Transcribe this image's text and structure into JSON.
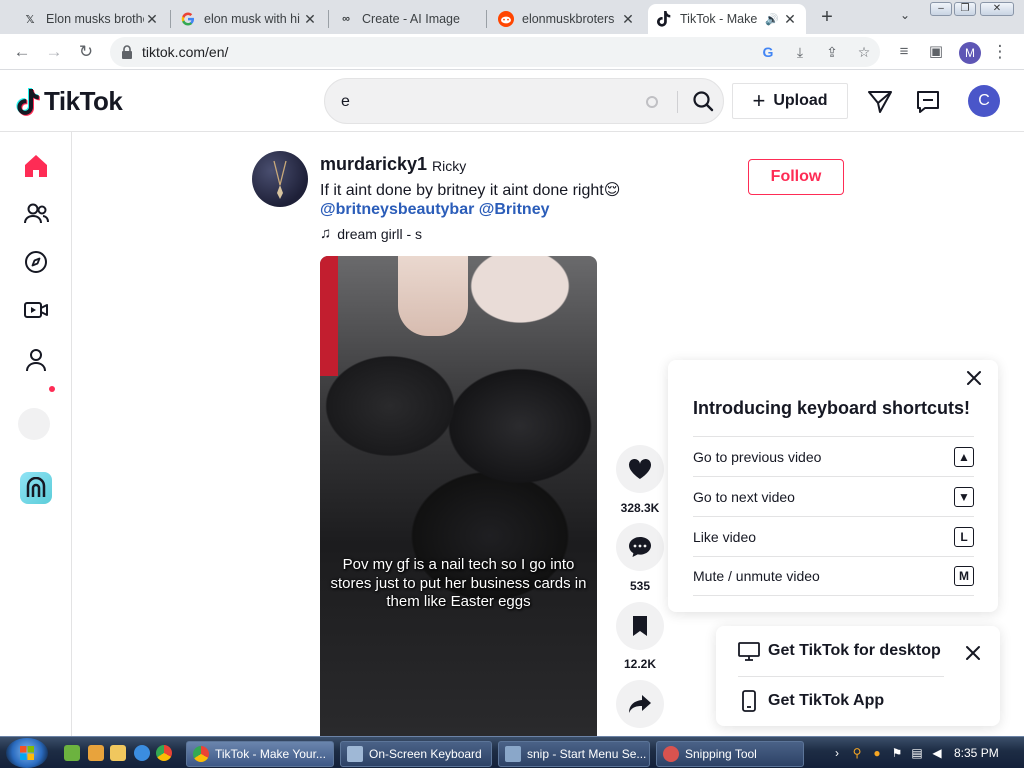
{
  "browser": {
    "tabs": [
      {
        "title": "Elon musks brothe",
        "favicon": "x-logo-icon"
      },
      {
        "title": "elon musk with hi",
        "favicon": "google-icon"
      },
      {
        "title": "Create - AI Image",
        "favicon": "bing-infinity-icon"
      },
      {
        "title": "elonmuskbroters",
        "favicon": "reddit-icon"
      },
      {
        "title": "TikTok - Make",
        "favicon": "tiktok-icon",
        "active": true
      }
    ],
    "url": "tiktok.com/en/",
    "profile_initial": "M"
  },
  "header": {
    "logo_text": "TikTok",
    "search_value": "e",
    "upload_label": "Upload",
    "avatar_initial": "C"
  },
  "post": {
    "username": "murdaricky1",
    "nickname": "Ricky",
    "caption": "If it aint done by britney it aint done right😌",
    "tags": "@britneysbeautybar @Britney",
    "music": "dream girll - s",
    "follow_label": "Follow",
    "video_caption": "Pov my gf is a nail tech so I go into stores just to put her business cards in them like Easter eggs"
  },
  "actions": {
    "likes": "328.3K",
    "comments": "535",
    "saves": "12.2K"
  },
  "shortcuts": {
    "title": "Introducing keyboard shortcuts!",
    "items": [
      {
        "label": "Go to previous video",
        "key": "▲"
      },
      {
        "label": "Go to next video",
        "key": "▼"
      },
      {
        "label": "Like video",
        "key": "L"
      },
      {
        "label": "Mute / unmute video",
        "key": "M"
      }
    ]
  },
  "get_app": {
    "desktop_label": "Get TikTok for desktop",
    "app_label": "Get TikTok App"
  },
  "taskbar": {
    "buttons": [
      {
        "label": "TikTok - Make Your..."
      },
      {
        "label": "On-Screen Keyboard"
      },
      {
        "label": "snip - Start Menu Se..."
      },
      {
        "label": "Snipping Tool"
      }
    ],
    "clock": "8:35 PM"
  },
  "colors": {
    "tiktok_red": "#fe2c55",
    "link_blue": "#2b5db9",
    "avatar_blue": "#4a56c9"
  }
}
